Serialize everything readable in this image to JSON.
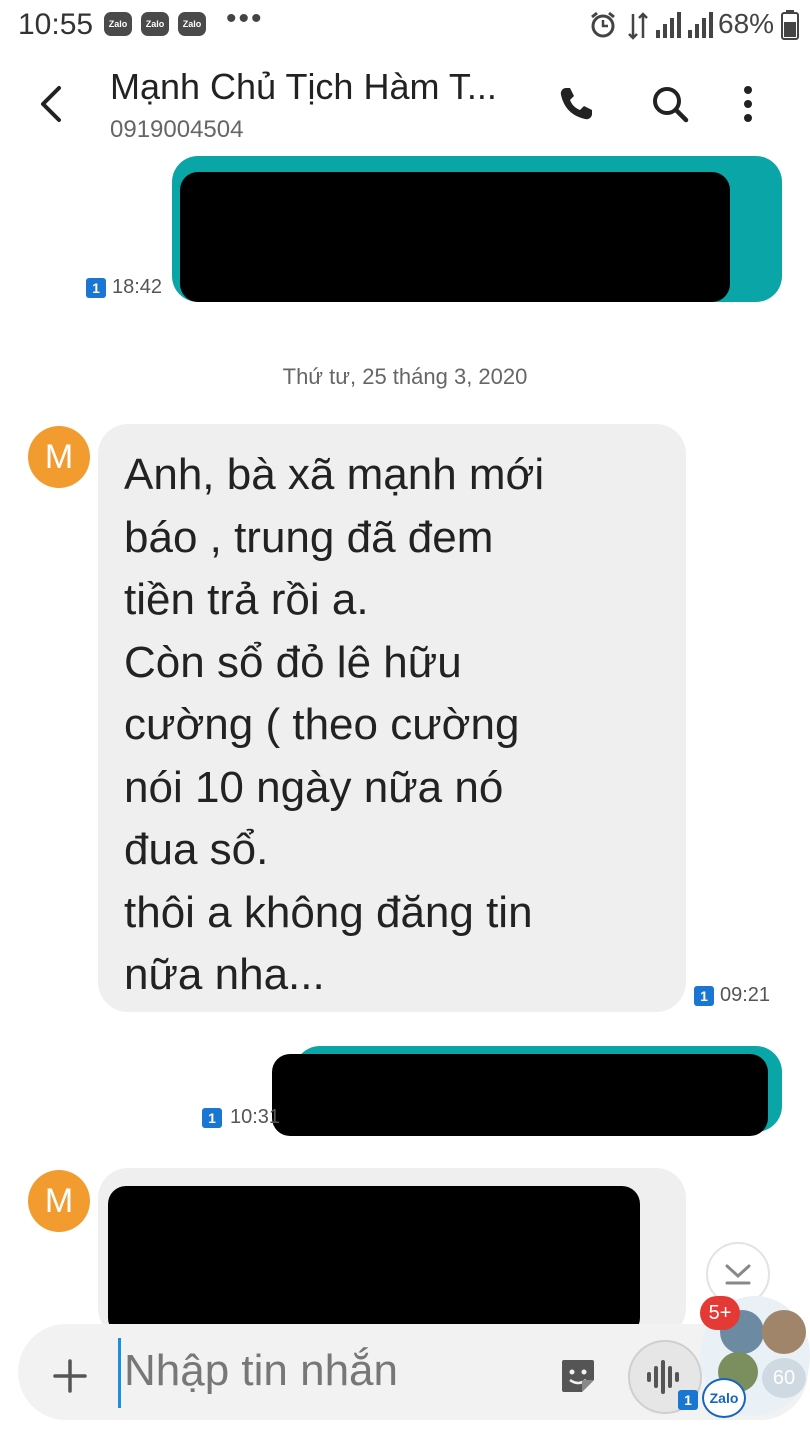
{
  "status_bar": {
    "time": "10:55",
    "app_icons": [
      "Zalo",
      "Zalo",
      "Zalo"
    ],
    "more": "•••",
    "battery": "68%"
  },
  "header": {
    "contact_name": "Mạnh Chủ Tịch Hàm T...",
    "phone_number": "0919004504"
  },
  "messages": {
    "out_1": {
      "sim": "1",
      "time": "18:42"
    },
    "date_separator": "Thứ tư, 25 tháng 3, 2020",
    "in_1": {
      "avatar_letter": "M",
      "text": "Anh, bà xã mạnh mới\nbáo , trung đã đem\ntiền trả rồi a.\nCòn sổ đỏ lê hữu\ncường ( theo cường\nnói 10 ngày nữa nó\nđua sổ.\nthôi a không đăng tin\nnữa nha...",
      "sim": "1",
      "time": "09:21"
    },
    "out_2": {
      "sim": "1",
      "time": "10:31"
    },
    "in_2": {
      "avatar_letter": "M"
    }
  },
  "composer": {
    "placeholder": "Nhập tin nhắn",
    "add": "+"
  },
  "floating": {
    "unread_badge": "5+",
    "count": "60",
    "zalo_label": "Zalo",
    "sim": "1"
  },
  "colors": {
    "outgoing_bubble": "#0aa6a7",
    "incoming_bubble": "#efefef",
    "avatar": "#f29c2f",
    "sim_badge": "#1976d2"
  }
}
